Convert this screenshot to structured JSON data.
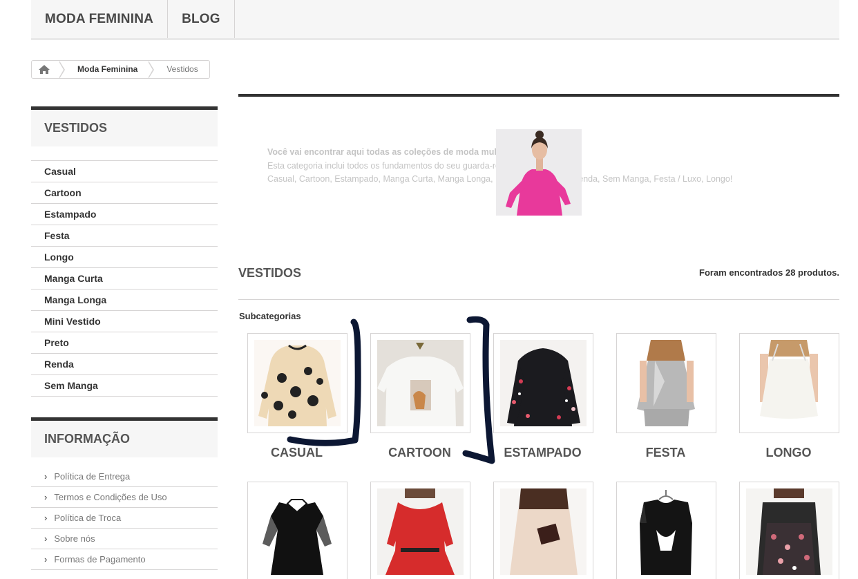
{
  "topnav": {
    "items": [
      "MODA FEMININA",
      "BLOG"
    ]
  },
  "breadcrumb": {
    "items": [
      "Moda Feminina",
      "Vestidos"
    ]
  },
  "sidebar": {
    "category_title": "VESTIDOS",
    "categories": [
      "Casual",
      "Cartoon",
      "Estampado",
      "Festa",
      "Longo",
      "Manga Curta",
      "Manga Longa",
      "Mini Vestido",
      "Preto",
      "Renda",
      "Sem Manga"
    ],
    "info_title": "INFORMAÇÃO",
    "info_items": [
      "Política de Entrega",
      "Termos e Condições de Uso",
      "Política de Troca",
      "Sobre nós",
      "Formas de Pagamento"
    ]
  },
  "description": {
    "line1": "Você vai encontrar aqui todas as coleções de moda mulher",
    "line2": "Esta categoria inclui todos os fundamentos do seu guarda-roupa e muito mais:",
    "line3": "Casual, Cartoon, Estampado, Manga Curta, Manga Longa, Mini Vestido, Preto, Renda, Sem Manga, Festa / Luxo, Longo!"
  },
  "main": {
    "heading": "VESTIDOS",
    "count": "Foram encontrados 28 produtos.",
    "subcategories_label": "Subcategorias",
    "subcategories": [
      "CASUAL",
      "CARTOON",
      "ESTAMPADO",
      "FESTA",
      "LONGO"
    ]
  },
  "colors": {
    "accent_dark": "#333333",
    "panel_bg": "#f6f6f6",
    "border": "#d6d4d4",
    "hero_pink": "#e8399b"
  }
}
